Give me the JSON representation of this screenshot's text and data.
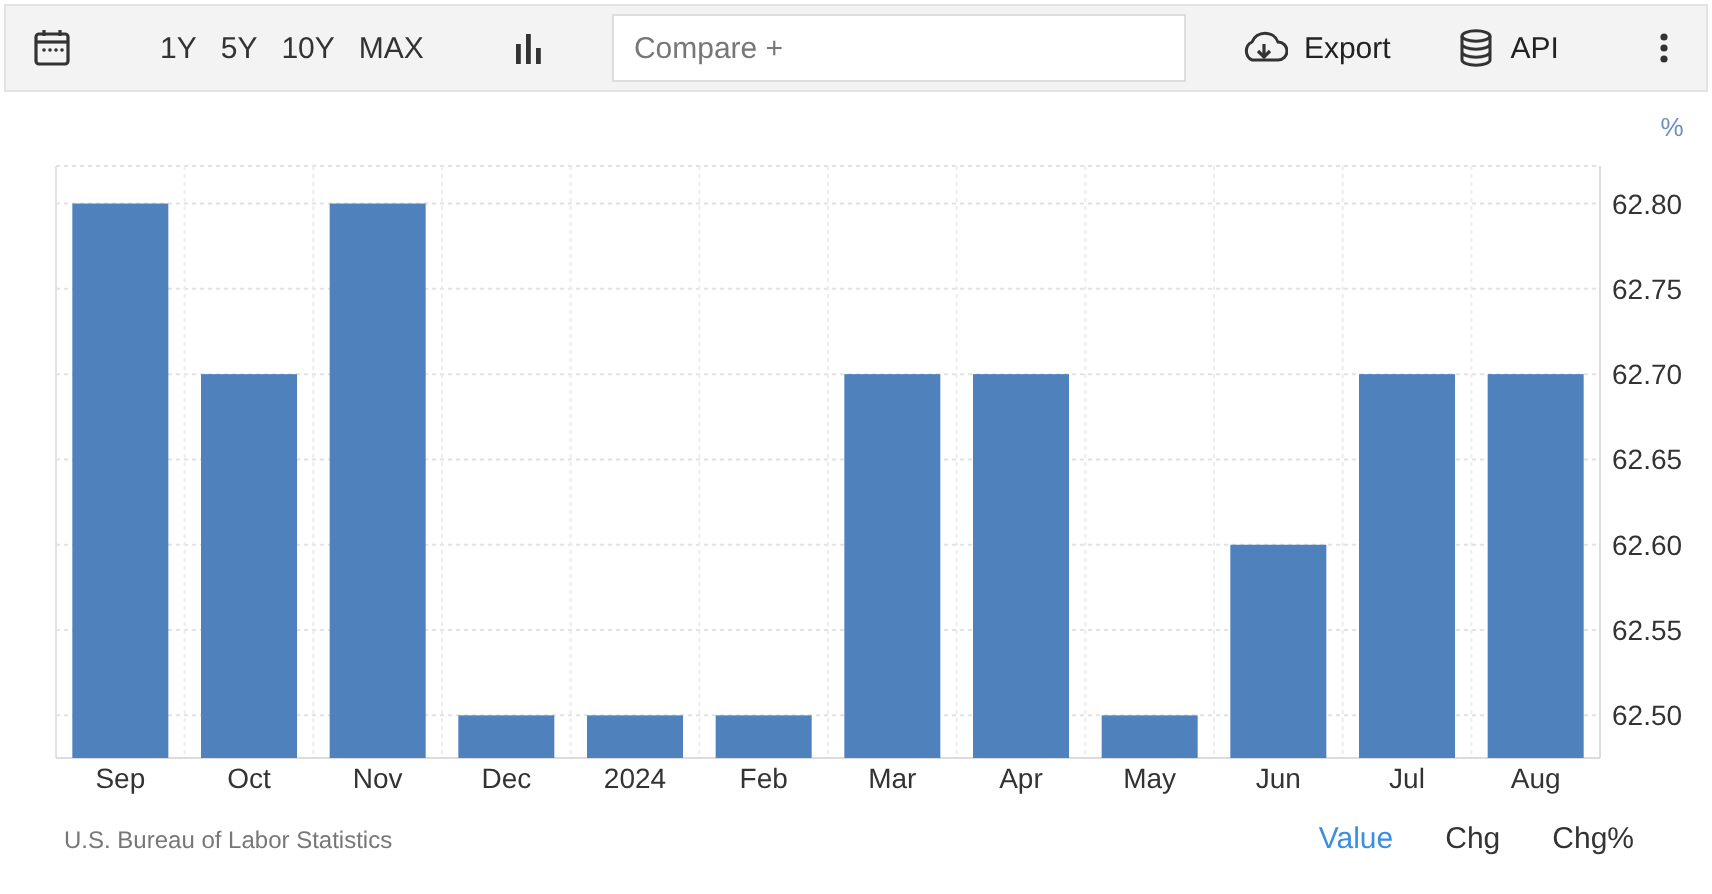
{
  "toolbar": {
    "ranges": [
      "1Y",
      "5Y",
      "10Y",
      "MAX"
    ],
    "compare": {
      "placeholder": "Compare +"
    },
    "export": "Export",
    "api": "API"
  },
  "chart": {
    "unit": "%",
    "chart_data": {
      "type": "bar",
      "categories": [
        "Sep",
        "Oct",
        "Nov",
        "Dec",
        "2024",
        "Feb",
        "Mar",
        "Apr",
        "May",
        "Jun",
        "Jul",
        "Aug"
      ],
      "grid": true,
      "series": [
        {
          "color": "#4f81bd",
          "values": [
            62.8,
            62.7,
            62.8,
            62.5,
            62.5,
            62.5,
            62.7,
            62.7,
            62.5,
            62.6,
            62.7,
            62.7
          ]
        }
      ],
      "ylim": [
        62.475,
        62.822
      ],
      "yticks": [
        {
          "value": 62.5,
          "label": "62.50"
        },
        {
          "value": 62.55,
          "label": "62.55"
        },
        {
          "value": 62.6,
          "label": "62.60"
        },
        {
          "value": 62.65,
          "label": "62.65"
        },
        {
          "value": 62.7,
          "label": "62.70"
        },
        {
          "value": 62.75,
          "label": "62.75"
        },
        {
          "value": 62.8,
          "label": "62.80"
        }
      ]
    }
  },
  "source": "U.S. Bureau of Labor Statistics",
  "views": [
    {
      "label": "Value",
      "selected": true
    },
    {
      "label": "Chg",
      "selected": false
    },
    {
      "label": "Chg%",
      "selected": false
    }
  ]
}
